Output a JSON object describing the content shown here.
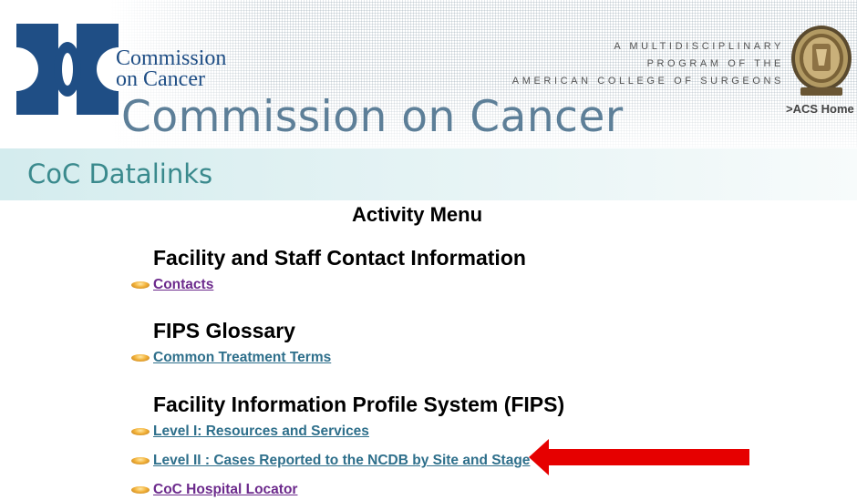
{
  "header": {
    "logo_line1": "Commission",
    "logo_line2": "on Cancer",
    "big_title": "Commission on Cancer",
    "acs_tagline": [
      "A MULTIDISCIPLINARY",
      "PROGRAM OF THE",
      "AMERICAN COLLEGE OF SURGEONS"
    ],
    "acs_home_link": ">ACS Home"
  },
  "datalinks": {
    "title": "CoC Datalinks"
  },
  "menu": {
    "title": "Activity Menu",
    "sections": [
      {
        "heading": "Facility and Staff Contact Information",
        "links": [
          {
            "label": "Contacts"
          }
        ]
      },
      {
        "heading": "FIPS Glossary",
        "links": [
          {
            "label": "Common Treatment Terms"
          }
        ]
      },
      {
        "heading": "Facility Information Profile System (FIPS)",
        "links": [
          {
            "label": "Level I: Resources and Services"
          },
          {
            "label": "Level II : Cases Reported to the NCDB by Site and Stage"
          },
          {
            "label": "CoC Hospital Locator"
          }
        ]
      }
    ]
  },
  "colors": {
    "logo_blue": "#1f4e85",
    "title_slate": "#5d7f98",
    "datalinks_teal": "#3a8a8d",
    "link_teal": "#2e6f8b",
    "link_purple": "#6c2a8c",
    "arrow_red": "#e60000"
  },
  "icons": {
    "bullet": "gold-oval-bullet-icon",
    "arrow": "red-left-arrow-icon",
    "seal": "acs-seal-icon"
  }
}
